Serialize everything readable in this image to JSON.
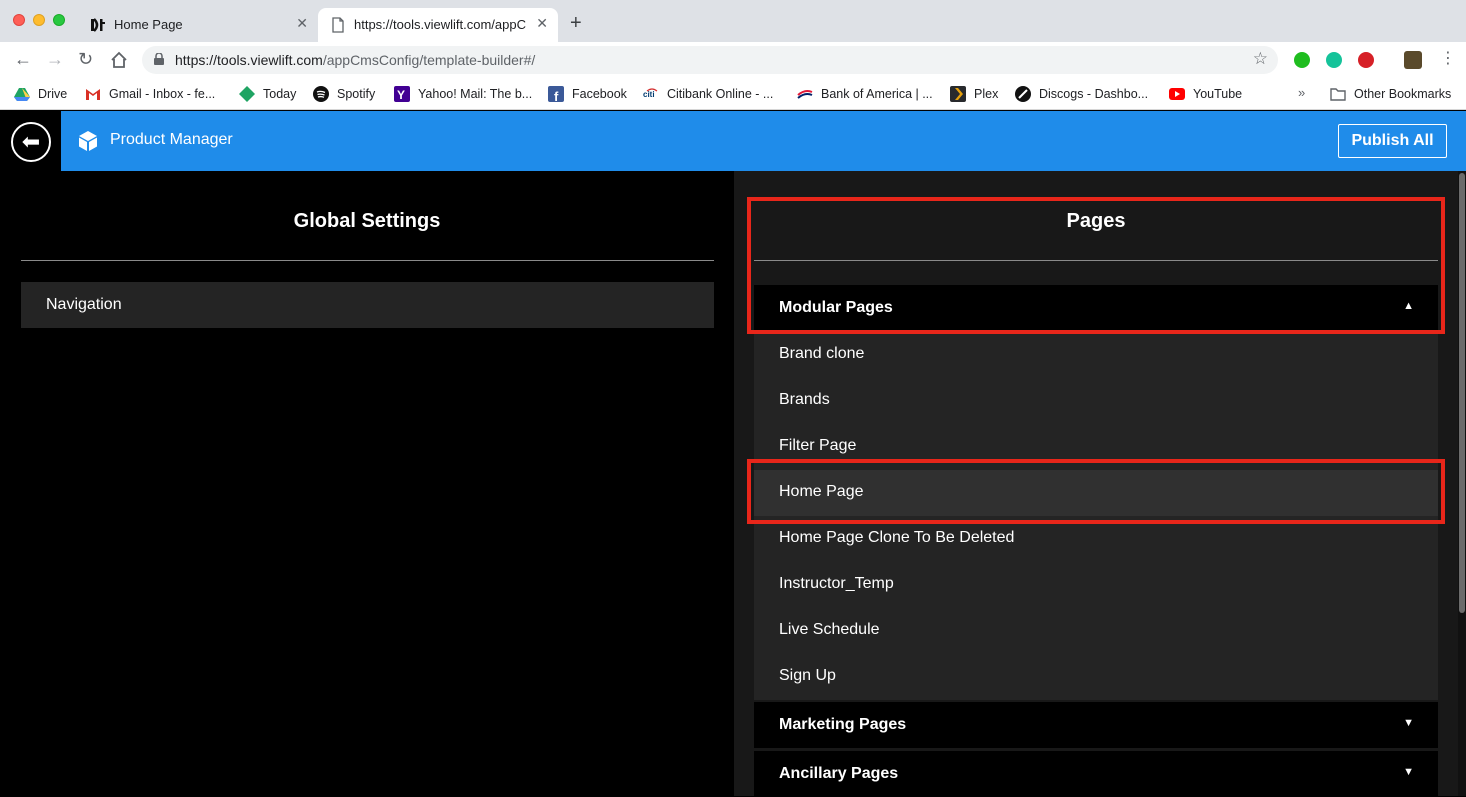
{
  "browser": {
    "tabs": [
      {
        "title": "Home Page",
        "close": "✕"
      },
      {
        "title": "https://tools.viewlift.com/appC",
        "close": "✕"
      }
    ],
    "new_tab": "+",
    "url_host": "https://tools.viewlift.com",
    "url_path": "/appCmsConfig/template-builder#/",
    "bookmarks": [
      "Drive",
      "Gmail - Inbox - fe...",
      "Today",
      "Spotify",
      "Yahoo! Mail: The b...",
      "Facebook",
      "Citibank Online - ...",
      "Bank of America | ...",
      "Plex",
      "Discogs - Dashbo...",
      "YouTube"
    ],
    "bookmarks_more": "»",
    "other_bookmarks": "Other Bookmarks"
  },
  "app": {
    "title": "Product Manager",
    "publish_label": "Publish All",
    "back_glyph": "⬅"
  },
  "global_settings": {
    "heading": "Global Settings",
    "items": [
      "Navigation"
    ]
  },
  "pages": {
    "heading": "Pages",
    "sections": [
      {
        "label": "Modular Pages",
        "expanded": true,
        "caret": "▲"
      },
      {
        "label": "Marketing Pages",
        "expanded": false,
        "caret": "▼"
      },
      {
        "label": "Ancillary Pages",
        "expanded": false,
        "caret": "▼"
      }
    ],
    "modular_items": [
      "Brand clone",
      "Brands",
      "Filter Page",
      "Home Page",
      "Home Page Clone To Be Deleted",
      "Instructor_Temp",
      "Live Schedule",
      "Sign Up"
    ],
    "selected_item": "Home Page"
  },
  "colors": {
    "header_blue": "#1f8cea",
    "highlight_red": "#e8261a"
  }
}
